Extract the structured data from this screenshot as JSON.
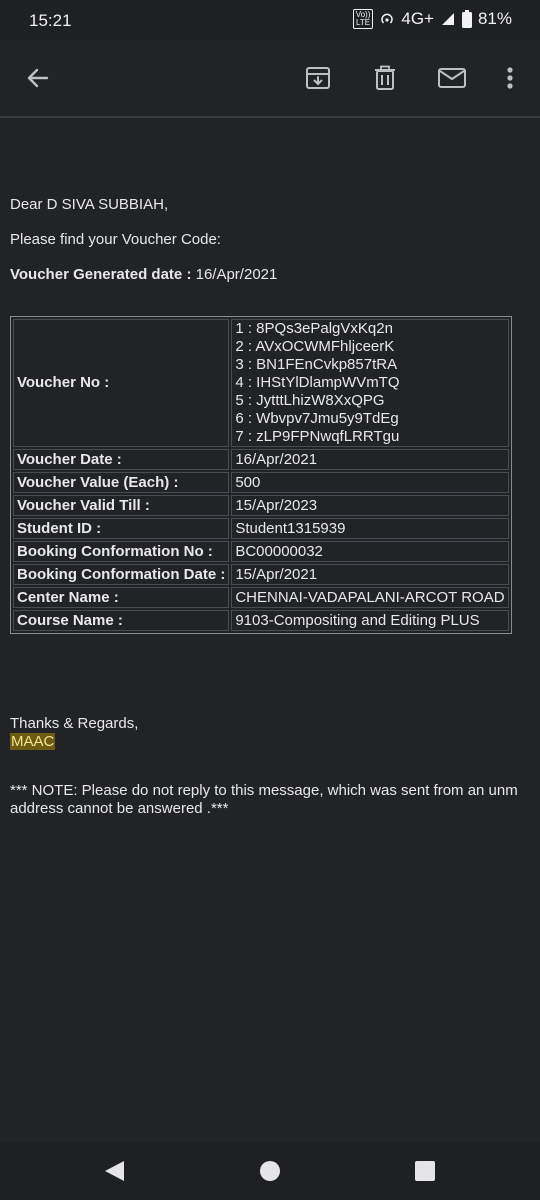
{
  "status_bar": {
    "time": "15:21",
    "network": "4G+",
    "battery": "81%",
    "volte_top": "Vo))",
    "volte_bottom": "LTE"
  },
  "app_bar": {
    "icons": [
      "back-arrow-icon",
      "archive-icon",
      "delete-icon",
      "mark-unread-icon",
      "more-vert-icon"
    ]
  },
  "email": {
    "greeting": "Dear D SIVA SUBBIAH,",
    "intro": "Please find your Voucher Code:",
    "generated_label": "Voucher Generated date : ",
    "generated_date": "16/Apr/2021",
    "voucher_no_label": "Voucher No :",
    "voucher_codes": [
      "1 : 8PQs3ePalgVxKq2n",
      "2 : AVxOCWMFhljceerK",
      "3 : BN1FEnCvkp857tRA",
      "4 : IHStYlDlampWVmTQ",
      "5 : JytttLhizW8XxQPG",
      "6 : Wbvpv7Jmu5y9TdEg",
      "7 : zLP9FPNwqfLRRTgu"
    ],
    "rows": [
      {
        "label": "Voucher Date :",
        "value": "16/Apr/2021"
      },
      {
        "label": "Voucher Value (Each) :",
        "value": "500"
      },
      {
        "label": "Voucher Valid Till :",
        "value": "15/Apr/2023"
      },
      {
        "label": "Student ID :",
        "value": "Student1315939"
      },
      {
        "label": "Booking Conformation No :",
        "value": "BC00000032"
      },
      {
        "label": "Booking Conformation Date :",
        "value": "15/Apr/2021"
      },
      {
        "label": "Center Name :",
        "value": "CHENNAI-VADAPALANI-ARCOT ROAD"
      },
      {
        "label": "Course Name :",
        "value": "9103-Compositing and Editing PLUS"
      }
    ],
    "regards": "Thanks & Regards,",
    "sender": "MAAC",
    "note_line1": "*** NOTE: Please do not reply to this message, which was sent from an unm",
    "note_line2": "address cannot be answered .***"
  },
  "colors": {
    "background": "#222327",
    "highlight": "#6b5b13",
    "text": "#e8e8ea"
  }
}
